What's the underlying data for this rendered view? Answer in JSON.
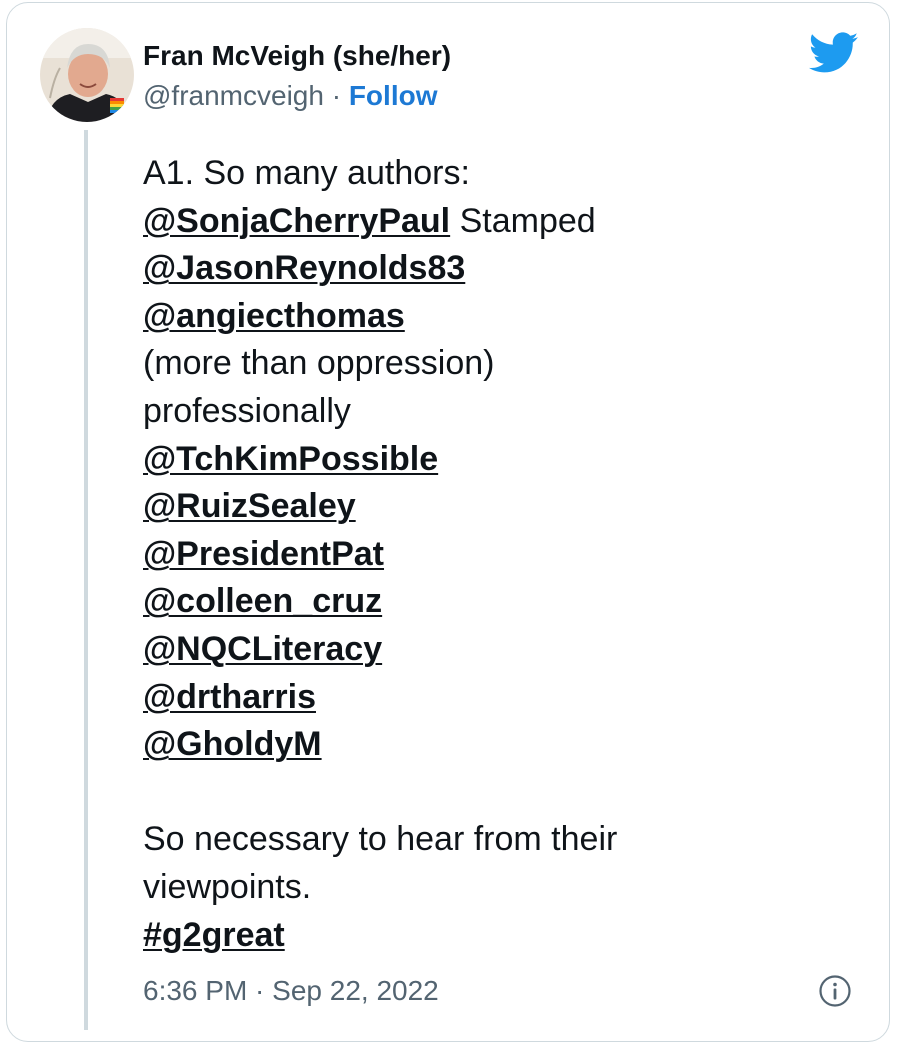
{
  "tweet": {
    "author_name": "Fran McVeigh (she/her)",
    "handle": "@franmcveigh",
    "separator": "·",
    "follow_label": "Follow",
    "text_line_1": "A1. So many authors:",
    "mention_1": "@SonjaCherryPaul",
    "text_after_mention_1": " Stamped",
    "mention_2": "@JasonReynolds83",
    "mention_3": "@angiecthomas",
    "text_line_5": "(more than oppression)",
    "text_line_6": "professionally",
    "mention_4": "@TchKimPossible",
    "mention_5": "@RuizSealey",
    "mention_6": "@PresidentPat",
    "mention_7": "@colleen_cruz",
    "mention_8": "@NQCLiteracy",
    "mention_9": "@drtharris",
    "mention_10": "@GholdyM",
    "text_line_15": "So necessary to hear from their",
    "text_line_16": "viewpoints.",
    "hashtag": "#g2great",
    "timestamp": "6:36 PM · Sep 22, 2022"
  },
  "colors": {
    "follow_blue": "#1d79d4",
    "twitter_blue": "#1d9bf0",
    "muted_gray": "#536471",
    "border": "#cfd9de"
  },
  "icons": {
    "brand": "twitter-bird-icon",
    "info": "info-icon"
  }
}
